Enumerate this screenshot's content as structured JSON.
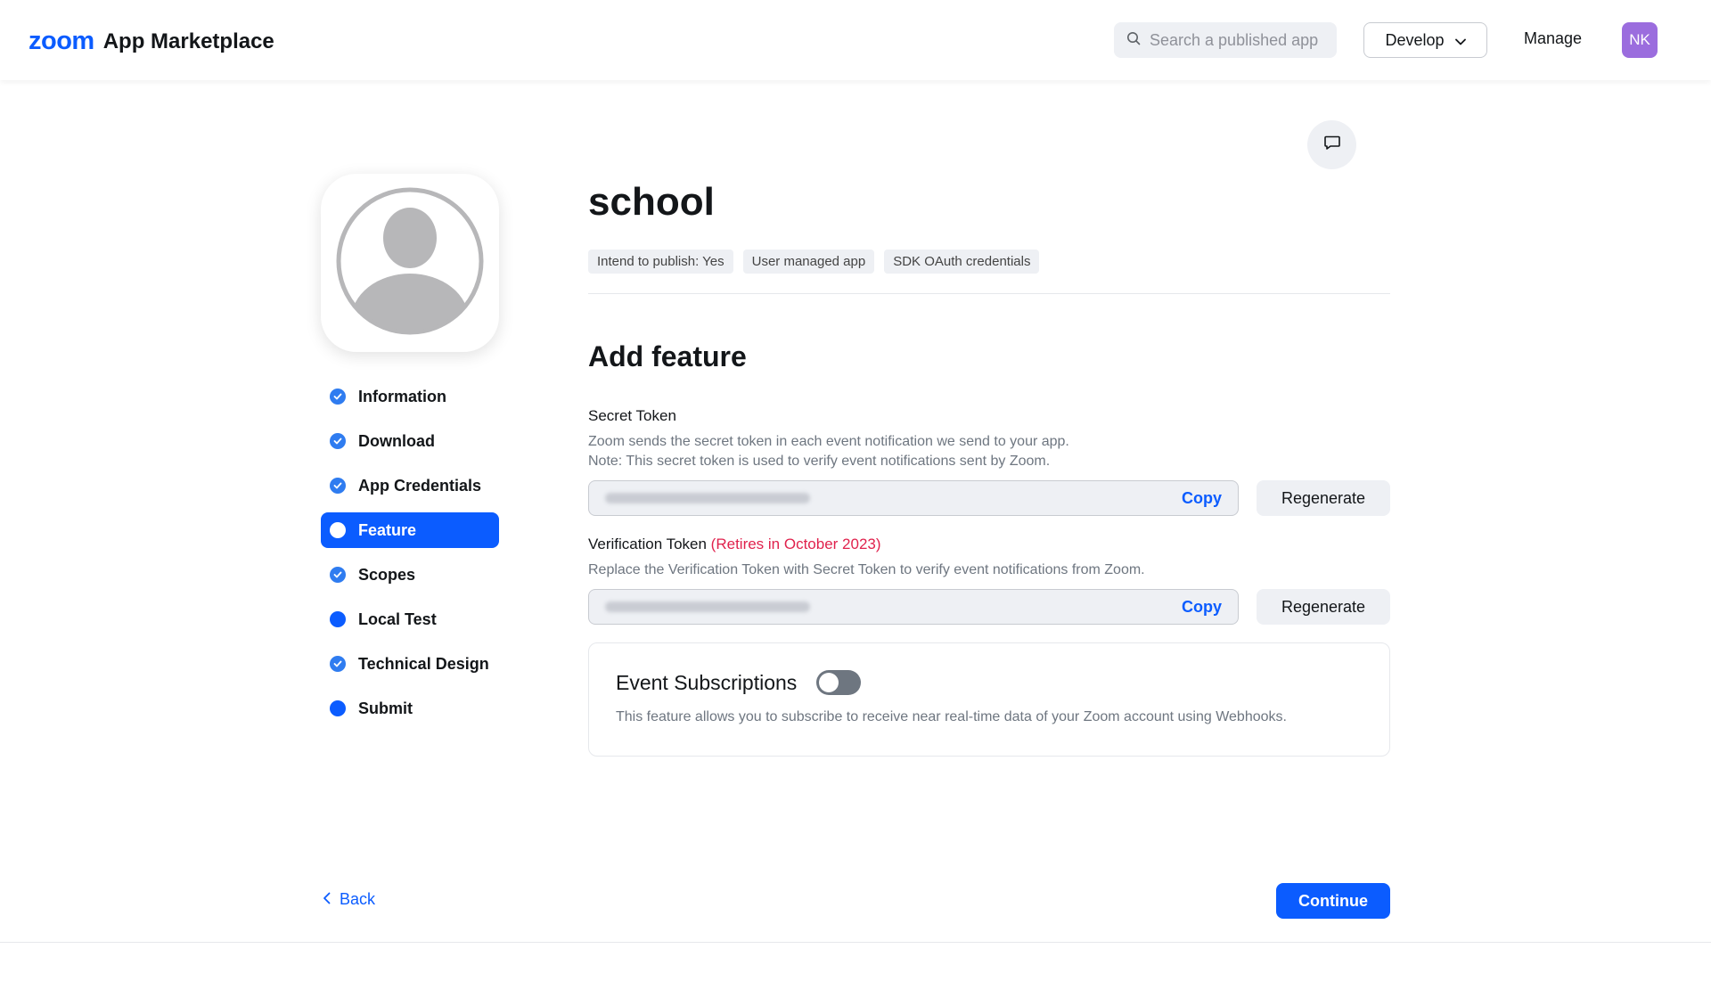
{
  "header": {
    "logo_brand": "zoom",
    "logo_text": "App Marketplace",
    "search_placeholder": "Search a published app",
    "develop_label": "Develop",
    "manage_label": "Manage",
    "user_initials": "NK"
  },
  "app": {
    "name": "school",
    "tags": [
      "Intend to publish: Yes",
      "User managed app",
      "SDK OAuth credentials"
    ]
  },
  "steps": [
    {
      "label": "Information",
      "state": "done"
    },
    {
      "label": "Download",
      "state": "done"
    },
    {
      "label": "App Credentials",
      "state": "done"
    },
    {
      "label": "Feature",
      "state": "active"
    },
    {
      "label": "Scopes",
      "state": "done"
    },
    {
      "label": "Local Test",
      "state": "pending"
    },
    {
      "label": "Technical Design",
      "state": "done"
    },
    {
      "label": "Submit",
      "state": "pending"
    }
  ],
  "feature": {
    "title": "Add feature",
    "secret": {
      "label": "Secret Token",
      "desc1": "Zoom sends the secret token in each event notification we send to your app.",
      "desc2": "Note: This secret token is used to verify event notifications sent by Zoom.",
      "copy": "Copy",
      "regenerate": "Regenerate"
    },
    "verification": {
      "label": "Verification Token",
      "warning": "(Retires in October 2023)",
      "desc": "Replace the Verification Token with Secret Token to verify event notifications from Zoom.",
      "copy": "Copy",
      "regenerate": "Regenerate"
    },
    "event": {
      "title": "Event Subscriptions",
      "enabled": false,
      "desc": "This feature allows you to subscribe to receive near real-time data of your Zoom account using Webhooks."
    }
  },
  "footer": {
    "back_label": "Back",
    "continue_label": "Continue"
  },
  "colors": {
    "accent": "#0b5cff",
    "warning": "#e0224d",
    "avatar": "#9b6dde"
  }
}
